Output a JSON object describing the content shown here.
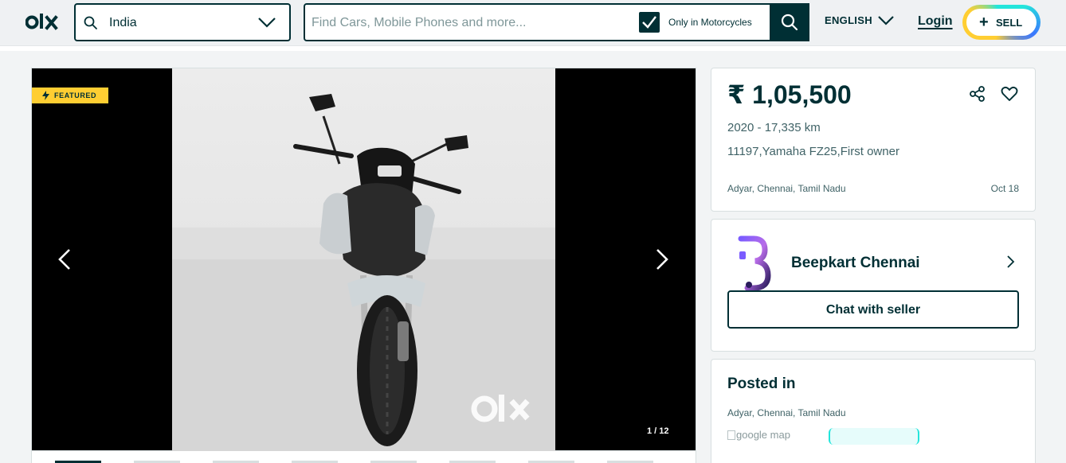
{
  "header": {
    "logo_alt": "olx",
    "location_value": "India",
    "search_placeholder": "Find Cars, Mobile Phones and more...",
    "filter_label": "Only in Motorcycles",
    "filter_checked": true,
    "language": "ENGLISH",
    "login_label": "Login",
    "sell_label": "SELL"
  },
  "gallery": {
    "badge": "FEATURED",
    "counter": "1 / 12",
    "watermark": "olx",
    "thumbnail_count": 8,
    "active_thumbnail": 1
  },
  "listing": {
    "price": "₹ 1,05,500",
    "year_km": "2020 - 17,335 km",
    "title": "11197,Yamaha FZ25,First owner",
    "location": "Adyar, Chennai, Tamil Nadu",
    "posted_date": "Oct 18"
  },
  "seller": {
    "name": "Beepkart Chennai",
    "chat_label": "Chat with seller"
  },
  "posted_in": {
    "heading": "Posted in",
    "location": "Adyar, Chennai, Tamil Nadu",
    "map_alt": "google map"
  },
  "colors": {
    "brand_dark": "#002f34",
    "featured_yellow": "#ffce32",
    "sell_cyan": "#23e5db",
    "sell_blue": "#3a77ff",
    "muted_text": "#406367"
  },
  "icons": [
    "olx-logo-icon",
    "search-icon",
    "chevron-down-icon",
    "checkmark-icon",
    "bolt-icon",
    "chevron-left-icon",
    "chevron-right-icon",
    "share-icon",
    "heart-icon",
    "seller-logo-icon"
  ]
}
